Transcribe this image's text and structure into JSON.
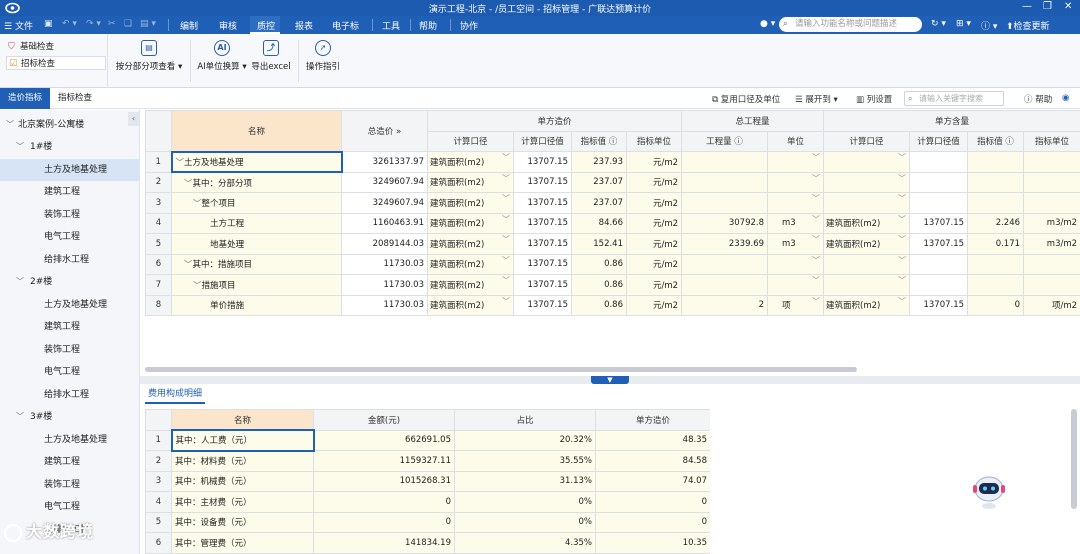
{
  "title_bar": {
    "title": "演示工程-北京 - /员工空间 - 招标管理 - 广联达预算计价"
  },
  "menubar": {
    "file_label": "文件",
    "tabs": [
      {
        "label": "编制"
      },
      {
        "label": "审核"
      },
      {
        "label": "质控"
      },
      {
        "label": "报表"
      },
      {
        "label": "电子标"
      },
      {
        "label": "工具"
      },
      {
        "label": "帮助"
      },
      {
        "label": "协作"
      }
    ],
    "active_tab": "质控",
    "search_placeholder": "请输入功能名称或问题描述",
    "check_update_label": "检查更新"
  },
  "ribbon": {
    "left_items": [
      {
        "label": "基础检查",
        "icon": "shield-icon"
      },
      {
        "label": "招标检查",
        "icon": "checklist-icon"
      }
    ],
    "buttons": [
      {
        "label": "按分部分项查看",
        "icon": "view-icon"
      },
      {
        "label": "AI单位换算",
        "icon": "ai-icon"
      },
      {
        "label": "导出excel",
        "icon": "excel-export-icon"
      },
      {
        "label": "操作指引",
        "icon": "compass-icon"
      }
    ]
  },
  "tabs_row": {
    "tabs": [
      {
        "label": "造价指标"
      },
      {
        "label": "指标检查"
      }
    ],
    "reuse_label": "复用口径及单位",
    "expand_label": "展开到",
    "column_setting_label": "列设置",
    "keyword_placeholder": "请输入关键字搜索",
    "help_label": "帮助"
  },
  "tree": {
    "root": "北京案例-公寓楼",
    "buildings": [
      {
        "label": "1#楼",
        "children": [
          "土方及地基处理",
          "建筑工程",
          "装饰工程",
          "电气工程",
          "给排水工程"
        ]
      },
      {
        "label": "2#楼",
        "children": [
          "土方及地基处理",
          "建筑工程",
          "装饰工程",
          "电气工程",
          "给排水工程"
        ]
      },
      {
        "label": "3#楼",
        "children": [
          "土方及地基处理",
          "建筑工程",
          "装饰工程",
          "电气工程",
          "给排水工程"
        ]
      }
    ]
  },
  "main_grid": {
    "headers": {
      "name": "名称",
      "total": "总造价",
      "unit_cost_group": "单方造价",
      "calc_basis": "计算口径",
      "basis_value": "计算口径值",
      "index_value": "指标值",
      "index_unit": "指标单位",
      "total_qty_group": "总工程量",
      "qty": "工程量",
      "unit": "单位",
      "unit_content_group": "单方含量",
      "calc_basis2": "计算口径",
      "basis_value2": "计算口径值",
      "index_value2": "指标值",
      "index_unit2": "指标单位"
    },
    "rows": [
      {
        "n": "1",
        "name": "土方及地基处理",
        "total": "3261337.97",
        "basis": "建筑面积(m2)",
        "bval": "13707.15",
        "idx": "237.93",
        "iunit": "元/m2",
        "qty": "",
        "unit": "",
        "basis2": "",
        "bval2": "",
        "idx2": "",
        "iunit2": ""
      },
      {
        "n": "2",
        "name": "其中：分部分项",
        "total": "3249607.94",
        "basis": "建筑面积(m2)",
        "bval": "13707.15",
        "idx": "237.07",
        "iunit": "元/m2",
        "qty": "",
        "unit": "",
        "basis2": "",
        "bval2": "",
        "idx2": "",
        "iunit2": ""
      },
      {
        "n": "3",
        "name": "整个项目",
        "total": "3249607.94",
        "basis": "建筑面积(m2)",
        "bval": "13707.15",
        "idx": "237.07",
        "iunit": "元/m2",
        "qty": "",
        "unit": "",
        "basis2": "",
        "bval2": "",
        "idx2": "",
        "iunit2": ""
      },
      {
        "n": "4",
        "name": "土方工程",
        "total": "1160463.91",
        "basis": "建筑面积(m2)",
        "bval": "13707.15",
        "idx": "84.66",
        "iunit": "元/m2",
        "qty": "30792.8",
        "unit": "m3",
        "basis2": "建筑面积(m2)",
        "bval2": "13707.15",
        "idx2": "2.246",
        "iunit2": "m3/m2"
      },
      {
        "n": "5",
        "name": "地基处理",
        "total": "2089144.03",
        "basis": "建筑面积(m2)",
        "bval": "13707.15",
        "idx": "152.41",
        "iunit": "元/m2",
        "qty": "2339.69",
        "unit": "m3",
        "basis2": "建筑面积(m2)",
        "bval2": "13707.15",
        "idx2": "0.171",
        "iunit2": "m3/m2"
      },
      {
        "n": "6",
        "name": "其中：措施项目",
        "total": "11730.03",
        "basis": "建筑面积(m2)",
        "bval": "13707.15",
        "idx": "0.86",
        "iunit": "元/m2",
        "qty": "",
        "unit": "",
        "basis2": "",
        "bval2": "",
        "idx2": "",
        "iunit2": ""
      },
      {
        "n": "7",
        "name": "措施项目",
        "total": "11730.03",
        "basis": "建筑面积(m2)",
        "bval": "13707.15",
        "idx": "0.86",
        "iunit": "元/m2",
        "qty": "",
        "unit": "",
        "basis2": "",
        "bval2": "",
        "idx2": "",
        "iunit2": ""
      },
      {
        "n": "8",
        "name": "单价措施",
        "total": "11730.03",
        "basis": "建筑面积(m2)",
        "bval": "13707.15",
        "idx": "0.86",
        "iunit": "元/m2",
        "qty": "2",
        "unit": "项",
        "basis2": "建筑面积(m2)",
        "bval2": "13707.15",
        "idx2": "0",
        "iunit2": "项/m2"
      }
    ]
  },
  "bottom": {
    "tab_label": "费用构成明细",
    "headers": {
      "name": "名称",
      "amount": "金额(元)",
      "ratio": "占比",
      "unit_cost": "单方造价"
    },
    "rows": [
      {
        "n": "1",
        "name": "其中：人工费（元）",
        "amount": "662691.05",
        "ratio": "20.32%",
        "unit_cost": "48.35"
      },
      {
        "n": "2",
        "name": "其中：材料费（元）",
        "amount": "1159327.11",
        "ratio": "35.55%",
        "unit_cost": "84.58"
      },
      {
        "n": "3",
        "name": "其中：机械费（元）",
        "amount": "1015268.31",
        "ratio": "31.13%",
        "unit_cost": "74.07"
      },
      {
        "n": "4",
        "name": "其中：主材费（元）",
        "amount": "0",
        "ratio": "0%",
        "unit_cost": "0"
      },
      {
        "n": "5",
        "name": "其中：设备费（元）",
        "amount": "0",
        "ratio": "0%",
        "unit_cost": "0"
      },
      {
        "n": "6",
        "name": "其中：管理费（元）",
        "amount": "141834.19",
        "ratio": "4.35%",
        "unit_cost": "10.35"
      }
    ]
  },
  "watermark": "大数跨境",
  "colors": {
    "brand_blue": "#1f5fb5",
    "yellow_cell": "#fdfbea",
    "name_header": "#fbe6cb"
  }
}
